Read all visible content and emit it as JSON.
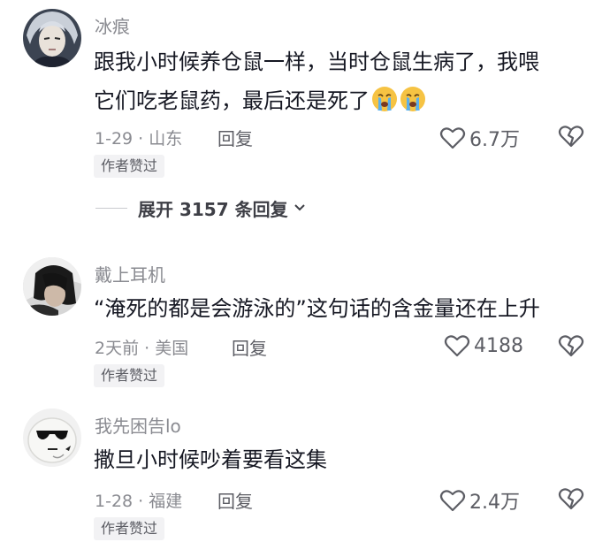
{
  "comments": [
    {
      "username": "冰痕",
      "text_line1": "跟我小时候养仓鼠一样，当时仓鼠生病了，我喂",
      "text_line2": "它们吃老鼠药，最后还是死了",
      "time": "1-29",
      "location": "山东",
      "reply_label": "回复",
      "likes": "6.7万",
      "badge": "作者赞过",
      "emoji": [
        "crying-face-icon",
        "crying-face-icon"
      ]
    },
    {
      "username": "戴上耳机",
      "text_line1": "“淹死的都是会游泳的”这句话的含金量还在上升",
      "time": "2天前",
      "location": "美国",
      "reply_label": "回复",
      "likes": "4188",
      "badge": "作者赞过"
    },
    {
      "username": "我先困告lo",
      "text_line1": "撒旦小时候吵着要看这集",
      "time": "1-28",
      "location": "福建",
      "reply_label": "回复",
      "likes": "2.4万",
      "badge": "作者赞过"
    }
  ],
  "expand_replies": {
    "label": "展开 3157 条回复"
  },
  "colors": {
    "text": "#161823",
    "muted": "#8a8b91",
    "badge_bg": "#f2f2f4"
  }
}
